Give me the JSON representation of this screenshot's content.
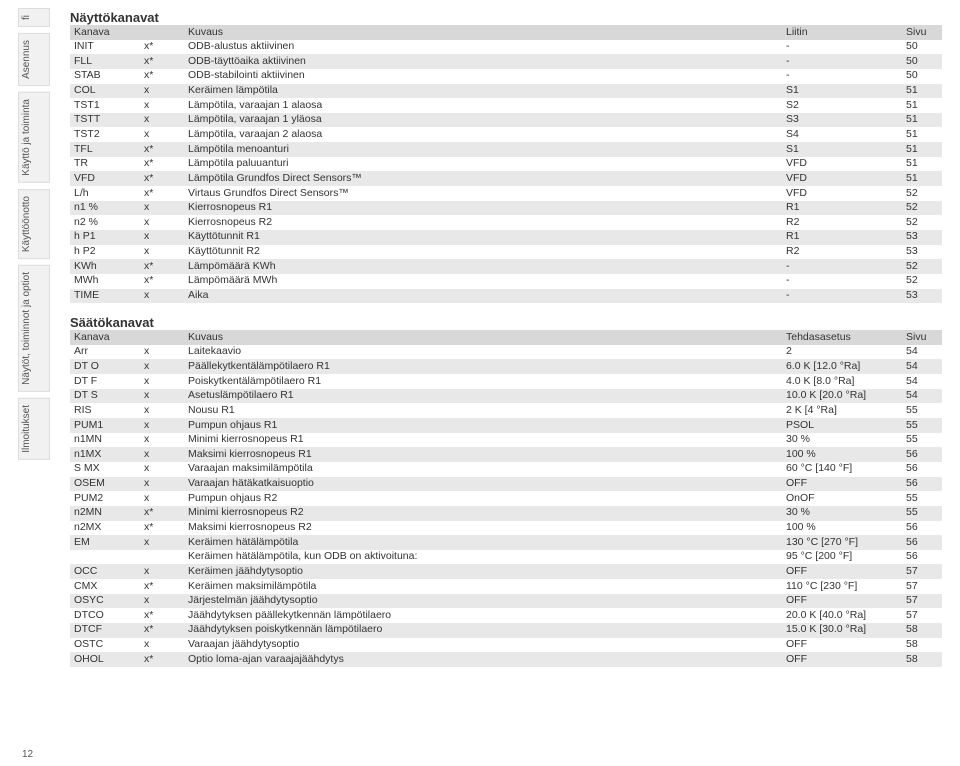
{
  "page_number": "12",
  "sidebar": [
    "fi",
    "Asennus",
    "Käyttö ja toiminta",
    "Käyttöönotto",
    "Näytöt, toiminnot ja optiot",
    "Ilmoitukset"
  ],
  "table1": {
    "title": "Näyttökanavat",
    "headers": [
      "Kanava",
      "",
      "Kuvaus",
      "Liitin",
      "Sivu"
    ],
    "rows": [
      [
        "INIT",
        "x*",
        "ODB-alustus aktiivinen",
        "-",
        "50"
      ],
      [
        "FLL",
        "x*",
        "ODB-täyttöaika aktiivinen",
        "-",
        "50"
      ],
      [
        "STAB",
        "x*",
        "ODB-stabilointi aktiivinen",
        "-",
        "50"
      ],
      [
        "COL",
        "x",
        "Keräimen lämpötila",
        "S1",
        "51"
      ],
      [
        "TST1",
        "x",
        "Lämpötila, varaajan 1 alaosa",
        "S2",
        "51"
      ],
      [
        "TSTT",
        "x",
        "Lämpötila, varaajan 1 yläosa",
        "S3",
        "51"
      ],
      [
        "TST2",
        "x",
        "Lämpötila, varaajan 2 alaosa",
        "S4",
        "51"
      ],
      [
        "TFL",
        "x*",
        "Lämpötila menoanturi",
        "S1",
        "51"
      ],
      [
        "TR",
        "x*",
        "Lämpötila paluuanturi",
        "VFD",
        "51"
      ],
      [
        "VFD",
        "x*",
        "Lämpötila Grundfos Direct Sensors™",
        "VFD",
        "51"
      ],
      [
        "L/h",
        "x*",
        "Virtaus Grundfos Direct Sensors™",
        "VFD",
        "52"
      ],
      [
        "n1 %",
        "x",
        "Kierrosnopeus R1",
        "R1",
        "52"
      ],
      [
        "n2 %",
        "x",
        "Kierrosnopeus R2",
        "R2",
        "52"
      ],
      [
        "h P1",
        "x",
        "Käyttötunnit R1",
        "R1",
        "53"
      ],
      [
        "h P2",
        "x",
        "Käyttötunnit R2",
        "R2",
        "53"
      ],
      [
        "KWh",
        "x*",
        "Lämpömäärä KWh",
        "-",
        "52"
      ],
      [
        "MWh",
        "x*",
        "Lämpömäärä MWh",
        "-",
        "52"
      ],
      [
        "TIME",
        "x",
        "Aika",
        "-",
        "53"
      ]
    ]
  },
  "table2": {
    "title": "Säätökanavat",
    "headers": [
      "Kanava",
      "",
      "Kuvaus",
      "Tehdasasetus",
      "Sivu"
    ],
    "rows": [
      [
        "Arr",
        "x",
        "Laitekaavio",
        "2",
        "54"
      ],
      [
        "DT O",
        "x",
        "Päällekytkentälämpötilaero R1",
        "6.0 K [12.0 °Ra]",
        "54"
      ],
      [
        "DT F",
        "x",
        "Poiskytkentälämpötilaero R1",
        "4.0 K [8.0 °Ra]",
        "54"
      ],
      [
        "DT S",
        "x",
        "Asetuslämpötilaero R1",
        "10.0 K [20.0 °Ra]",
        "54"
      ],
      [
        "RIS",
        "x",
        "Nousu R1",
        "2 K [4 °Ra]",
        "55"
      ],
      [
        "PUM1",
        "x",
        "Pumpun ohjaus R1",
        "PSOL",
        "55"
      ],
      [
        "n1MN",
        "x",
        "Minimi kierrosnopeus R1",
        "30 %",
        "55"
      ],
      [
        "n1MX",
        "x",
        "Maksimi kierrosnopeus R1",
        "100 %",
        "56"
      ],
      [
        "S MX",
        "x",
        "Varaajan maksimilämpötila",
        "60 °C [140 °F]",
        "56"
      ],
      [
        "OSEM",
        "x",
        "Varaajan hätäkatkaisuoptio",
        "OFF",
        "56"
      ],
      [
        "PUM2",
        "x",
        "Pumpun ohjaus R2",
        "OnOF",
        "55"
      ],
      [
        "n2MN",
        "x*",
        "Minimi kierrosnopeus R2",
        "30 %",
        "55"
      ],
      [
        "n2MX",
        "x*",
        "Maksimi kierrosnopeus R2",
        "100 %",
        "56"
      ],
      [
        "EM",
        "x",
        "Keräimen hätälämpötila",
        "130 °C [270 °F]",
        "56"
      ],
      [
        "",
        "",
        "Keräimen hätälämpötila, kun ODB on aktivoituna:",
        "95 °C [200 °F]",
        "56"
      ],
      [
        "OCC",
        "x",
        "Keräimen jäähdytysoptio",
        "OFF",
        "57"
      ],
      [
        "CMX",
        "x*",
        "Keräimen maksimilämpötila",
        "110 °C [230 °F]",
        "57"
      ],
      [
        "OSYC",
        "x",
        "Järjestelmän jäähdytysoptio",
        "OFF",
        "57"
      ],
      [
        "DTCO",
        "x*",
        "Jäähdytyksen päällekytkennän lämpötilaero",
        "20.0 K [40.0 °Ra]",
        "57"
      ],
      [
        "DTCF",
        "x*",
        "Jäähdytyksen poiskytkennän lämpötilaero",
        "15.0 K [30.0 °Ra]",
        "58"
      ],
      [
        "OSTC",
        "x",
        "Varaajan jäähdytysoptio",
        "OFF",
        "58"
      ],
      [
        "OHOL",
        "x*",
        "Optio loma-ajan varaajajäähdytys",
        "OFF",
        "58"
      ]
    ]
  }
}
